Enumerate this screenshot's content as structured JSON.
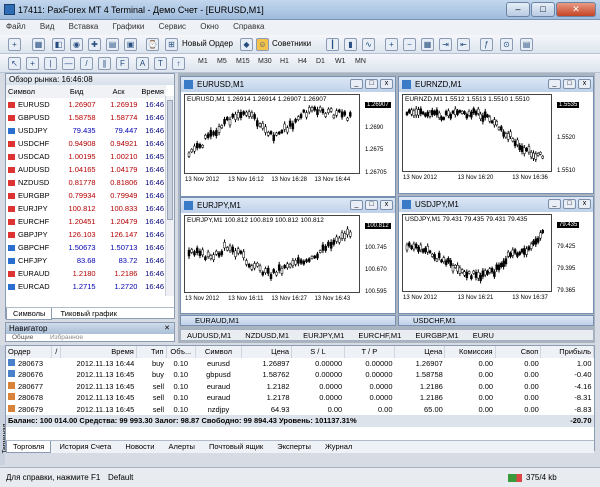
{
  "window": {
    "title": "17411: PaxForex MT 4 Terminal - Демо Счет - [EURUSD,M1]",
    "min": "–",
    "max": "□",
    "close": "✕"
  },
  "menu": [
    "Файл",
    "Вид",
    "Вставка",
    "Графики",
    "Сервис",
    "Окно",
    "Справка"
  ],
  "toolbar": {
    "new_order": "Новый Ордер",
    "experts": "Советники"
  },
  "timeframes": [
    "M1",
    "M5",
    "M15",
    "M30",
    "H1",
    "H4",
    "D1",
    "W1",
    "MN"
  ],
  "market_watch": {
    "title": "Обзор рынка: 16:46:08",
    "headers": [
      "Символ",
      "Бид",
      "Аск",
      "Время"
    ],
    "rows": [
      {
        "s": "EURUSD",
        "b": "1.26907",
        "a": "1.26919",
        "t": "16:46",
        "d": "dn"
      },
      {
        "s": "GBPUSD",
        "b": "1.58758",
        "a": "1.58774",
        "t": "16:46",
        "d": "dn"
      },
      {
        "s": "USDJPY",
        "b": "79.435",
        "a": "79.447",
        "t": "16:46",
        "d": "up"
      },
      {
        "s": "USDCHF",
        "b": "0.94908",
        "a": "0.94921",
        "t": "16:46",
        "d": "dn"
      },
      {
        "s": "USDCAD",
        "b": "1.00195",
        "a": "1.00210",
        "t": "16:45",
        "d": "dn"
      },
      {
        "s": "AUDUSD",
        "b": "1.04165",
        "a": "1.04179",
        "t": "16:46",
        "d": "dn"
      },
      {
        "s": "NZDUSD",
        "b": "0.81778",
        "a": "0.81806",
        "t": "16:46",
        "d": "dn"
      },
      {
        "s": "EURGBP",
        "b": "0.79934",
        "a": "0.79949",
        "t": "16:46",
        "d": "dn"
      },
      {
        "s": "EURJPY",
        "b": "100.812",
        "a": "100.833",
        "t": "16:46",
        "d": "dn"
      },
      {
        "s": "EURCHF",
        "b": "1.20451",
        "a": "1.20479",
        "t": "16:46",
        "d": "dn"
      },
      {
        "s": "GBPJPY",
        "b": "126.103",
        "a": "126.147",
        "t": "16:46",
        "d": "dn"
      },
      {
        "s": "GBPCHF",
        "b": "1.50673",
        "a": "1.50713",
        "t": "16:46",
        "d": "up"
      },
      {
        "s": "CHFJPY",
        "b": "83.68",
        "a": "83.72",
        "t": "16:46",
        "d": "up"
      },
      {
        "s": "EURAUD",
        "b": "1.2180",
        "a": "1.2186",
        "t": "16:46",
        "d": "dn"
      },
      {
        "s": "EURCAD",
        "b": "1.2715",
        "a": "1.2720",
        "t": "16:46",
        "d": "up"
      }
    ],
    "tabs": [
      "Символы",
      "Тиковый график"
    ]
  },
  "navigator": {
    "title": "Навигатор",
    "close": "✕",
    "tab_hint": "Общие",
    "tab_hint2": "Избранное"
  },
  "charts": [
    {
      "title": "EURUSD,M1",
      "info": "EURUSD,M1  1.26914 1.26914 1.26907 1.26907",
      "prices": [
        "1.26907",
        "1.2690",
        "1.2675",
        "1.26705"
      ],
      "dates": [
        "13 Nov 2012",
        "13 Nov 16:12",
        "13 Nov 16:28",
        "13 Nov 16:44"
      ]
    },
    {
      "title": "EURNZD,M1",
      "info": "EURNZD,M1  1.5512 1.5513 1.5510 1.5510",
      "prices": [
        "1.5535",
        "1.5520",
        "1.5510"
      ],
      "dates": [
        "13 Nov 2012",
        "13 Nov 16:20",
        "13 Nov 16:36"
      ]
    },
    {
      "title": "EURJPY,M1",
      "info": "EURJPY,M1  100.812 100.819 100.812 100.812",
      "prices": [
        "100.812",
        "100.745",
        "100.670",
        "100.595"
      ],
      "dates": [
        "13 Nov 2012",
        "13 Nov 16:11",
        "13 Nov 16:27",
        "13 Nov 16:43"
      ]
    },
    {
      "title": "USDJPY,M1",
      "info": "USDJPY,M1  79.431 79.435 79.431 79.435",
      "prices": [
        "79.435",
        "79.425",
        "79.395",
        "79.365"
      ],
      "dates": [
        "13 Nov 2012",
        "13 Nov 16:21",
        "13 Nov 16:37"
      ]
    }
  ],
  "chart_buttons": {
    "min": "_",
    "max": "□",
    "close": "x"
  },
  "mini_windows": [
    "EURAUD,M1",
    "USDCHF,M1"
  ],
  "chart_tabs": [
    "AUDUSD,M1",
    "NZDUSD,M1",
    "EURJPY,M1",
    "EURCHF,M1",
    "EURGBP,M1",
    "EURU"
  ],
  "terminal": {
    "side_label": "Терминал",
    "headers": [
      "Ордер",
      "/",
      "Время",
      "Тип",
      "Объ...",
      "Символ",
      "Цена",
      "S / L",
      "T / P",
      "Цена",
      "Комиссия",
      "Своп",
      "Прибыль"
    ],
    "rows": [
      {
        "o": "280673",
        "time": "2012.11.13 16:44",
        "type": "buy",
        "vol": "0.10",
        "sym": "eurusd",
        "p": "1.26897",
        "sl": "0.00000",
        "tp": "0.00000",
        "cur": "1.26907",
        "com": "0.00",
        "swap": "0.00",
        "pr": "1.00"
      },
      {
        "o": "280676",
        "time": "2012.11.13 16:45",
        "type": "buy",
        "vol": "0.10",
        "sym": "gbpusd",
        "p": "1.58762",
        "sl": "0.00000",
        "tp": "0.00000",
        "cur": "1.58758",
        "com": "0.00",
        "swap": "0.00",
        "pr": "-0.40"
      },
      {
        "o": "280677",
        "time": "2012.11.13 16:45",
        "type": "sell",
        "vol": "0.10",
        "sym": "euraud",
        "p": "1.2182",
        "sl": "0.0000",
        "tp": "0.0000",
        "cur": "1.2186",
        "com": "0.00",
        "swap": "0.00",
        "pr": "-4.16"
      },
      {
        "o": "280678",
        "time": "2012.11.13 16:45",
        "type": "sell",
        "vol": "0.10",
        "sym": "euraud",
        "p": "1.2178",
        "sl": "0.0000",
        "tp": "0.0000",
        "cur": "1.2186",
        "com": "0.00",
        "swap": "0.00",
        "pr": "-8.31"
      },
      {
        "o": "280679",
        "time": "2012.11.13 16:45",
        "type": "sell",
        "vol": "0.10",
        "sym": "nzdjpy",
        "p": "64.93",
        "sl": "0.00",
        "tp": "0.00",
        "cur": "65.00",
        "com": "0.00",
        "swap": "0.00",
        "pr": "-8.83"
      }
    ],
    "balance": "Баланс: 100 014.00  Средства: 99 993.30  Залог: 98.87  Свободно: 99 894.43  Уровень: 101137.31%",
    "balance_profit": "-20.70",
    "tabs": [
      "Торговля",
      "История Счета",
      "Новости",
      "Алерты",
      "Почтовый ящик",
      "Эксперты",
      "Журнал"
    ]
  },
  "status": {
    "help": "Для справки, нажмите F1",
    "profile": "Default",
    "traffic": "375/4 kb"
  }
}
